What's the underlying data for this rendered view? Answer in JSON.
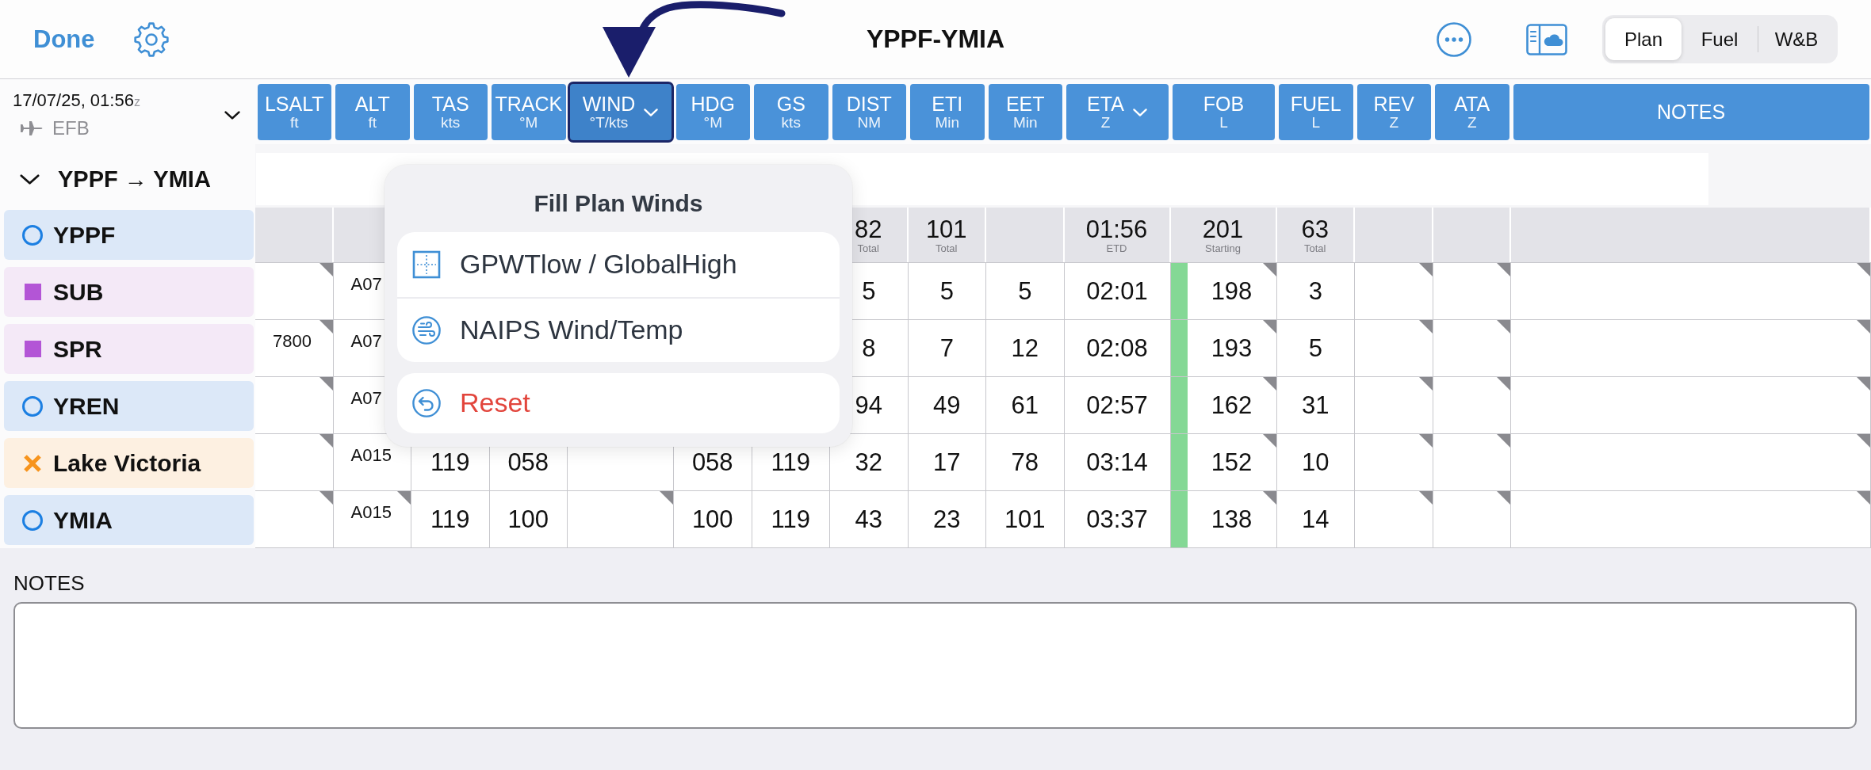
{
  "header": {
    "back": "Done",
    "title": "YPPF-YMIA",
    "segments": [
      {
        "label": "Plan",
        "selected": true
      },
      {
        "label": "Fuel",
        "selected": false
      },
      {
        "label": "W&B",
        "selected": false
      }
    ]
  },
  "plan_info": {
    "time": "17/07/25, 01:56",
    "zone": "z",
    "aircraft": "EFB"
  },
  "route": {
    "title": "YPPF → YMIA",
    "expanded": true,
    "waypoints": [
      {
        "name": "YPPF",
        "kind": "aerodrome"
      },
      {
        "name": "SUB",
        "kind": "fix"
      },
      {
        "name": "SPR",
        "kind": "fix"
      },
      {
        "name": "YREN",
        "kind": "aerodrome"
      },
      {
        "name": "Lake Victoria",
        "kind": "user"
      },
      {
        "name": "YMIA",
        "kind": "aerodrome"
      }
    ]
  },
  "table": {
    "columns": [
      {
        "label": "LSALT",
        "unit": "ft",
        "kind": "altitude",
        "menu": false,
        "selected": false
      },
      {
        "label": "ALT",
        "unit": "ft",
        "kind": "altitude",
        "menu": false,
        "selected": false
      },
      {
        "label": "TAS",
        "unit": "kts",
        "kind": "number",
        "menu": false,
        "selected": false
      },
      {
        "label": "TRACK",
        "unit": "°M",
        "kind": "number",
        "menu": false,
        "selected": false
      },
      {
        "label": "WIND",
        "unit": "°T/kts",
        "kind": "number",
        "menu": true,
        "selected": true
      },
      {
        "label": "HDG",
        "unit": "°M",
        "kind": "number",
        "menu": false,
        "selected": false
      },
      {
        "label": "GS",
        "unit": "kts",
        "kind": "number",
        "menu": false,
        "selected": false
      },
      {
        "label": "DIST",
        "unit": "NM",
        "kind": "number",
        "menu": false,
        "selected": false,
        "total": {
          "value": "82",
          "note": "Total"
        }
      },
      {
        "label": "ETI",
        "unit": "Min",
        "kind": "number",
        "menu": false,
        "selected": false,
        "total": {
          "value": "101",
          "note": "Total"
        }
      },
      {
        "label": "EET",
        "unit": "Min",
        "kind": "number",
        "menu": false,
        "selected": false
      },
      {
        "label": "ETA",
        "unit": "Z",
        "kind": "number",
        "menu": true,
        "selected": false,
        "total": {
          "value": "01:56",
          "note": "ETD"
        }
      },
      {
        "label": "FOB",
        "unit": "L",
        "kind": "fuel",
        "menu": false,
        "selected": false,
        "total": {
          "value": "201",
          "note": "Starting"
        }
      },
      {
        "label": "FUEL",
        "unit": "L",
        "kind": "number",
        "menu": false,
        "selected": false,
        "total": {
          "value": "63",
          "note": "Total"
        }
      },
      {
        "label": "REV",
        "unit": "Z",
        "kind": "number",
        "menu": false,
        "selected": false
      },
      {
        "label": "ATA",
        "unit": "Z",
        "kind": "number",
        "menu": false,
        "selected": false
      },
      {
        "label": "NOTES",
        "kind": "notes",
        "menu": false,
        "selected": false
      }
    ],
    "rows": [
      {
        "fuel_ok": true,
        "cells": {
          "lsalt": {
            "flagged": true
          },
          "alt": {
            "text": "A07"
          },
          "dist": {
            "text": "5",
            "flagged": false
          },
          "eti": {
            "text": "5",
            "flagged": false
          },
          "eet": {
            "text": "5",
            "flagged": false
          },
          "eta": {
            "text": "02:01",
            "flagged": false
          },
          "fob": {
            "text": "198",
            "flagged": true
          },
          "fuel": {
            "text": "3",
            "flagged": false
          },
          "rev": {
            "flagged": true
          },
          "ata": {
            "flagged": true
          },
          "notes": {
            "flagged": true
          }
        }
      },
      {
        "fuel_ok": true,
        "cells": {
          "lsalt": {
            "text": "7800",
            "flagged": true
          },
          "alt": {
            "text": "A07"
          },
          "dist": {
            "text": "8",
            "flagged": false
          },
          "eti": {
            "text": "7",
            "flagged": false
          },
          "eet": {
            "text": "12",
            "flagged": false
          },
          "eta": {
            "text": "02:08",
            "flagged": false
          },
          "fob": {
            "text": "193",
            "flagged": true
          },
          "fuel": {
            "text": "5",
            "flagged": false
          },
          "rev": {
            "flagged": true
          },
          "ata": {
            "flagged": true
          },
          "notes": {
            "flagged": true
          }
        }
      },
      {
        "fuel_ok": true,
        "cells": {
          "lsalt": {
            "flagged": true
          },
          "alt": {
            "text": "A07"
          },
          "dist": {
            "text": "94",
            "flagged": false
          },
          "eti": {
            "text": "49",
            "flagged": false
          },
          "eet": {
            "text": "61",
            "flagged": false
          },
          "eta": {
            "text": "02:57",
            "flagged": false
          },
          "fob": {
            "text": "162",
            "flagged": true
          },
          "fuel": {
            "text": "31",
            "flagged": false
          },
          "rev": {
            "flagged": true
          },
          "ata": {
            "flagged": true
          },
          "notes": {
            "flagged": true
          }
        }
      },
      {
        "fuel_ok": true,
        "cells": {
          "lsalt": {
            "flagged": true
          },
          "alt": {
            "text": "A015"
          },
          "tas": {
            "text": "119"
          },
          "track": {
            "text": "058"
          },
          "hdg": {
            "text": "058"
          },
          "gs": {
            "text": "119"
          },
          "dist": {
            "text": "32",
            "flagged": false
          },
          "eti": {
            "text": "17",
            "flagged": false
          },
          "eet": {
            "text": "78",
            "flagged": false
          },
          "eta": {
            "text": "03:14",
            "flagged": false
          },
          "fob": {
            "text": "152",
            "flagged": true
          },
          "fuel": {
            "text": "10",
            "flagged": false
          },
          "rev": {
            "flagged": true
          },
          "ata": {
            "flagged": true
          },
          "notes": {
            "flagged": true
          }
        }
      },
      {
        "fuel_ok": true,
        "cells": {
          "lsalt": {
            "flagged": true
          },
          "alt": {
            "text": "A015",
            "flagged": true
          },
          "tas": {
            "text": "119",
            "flagged": false
          },
          "track": {
            "text": "100",
            "flagged": false
          },
          "wind": {
            "flagged": true
          },
          "hdg": {
            "text": "100",
            "flagged": false
          },
          "gs": {
            "text": "119",
            "flagged": false
          },
          "dist": {
            "text": "43",
            "flagged": false
          },
          "eti": {
            "text": "23",
            "flagged": false
          },
          "eet": {
            "text": "101",
            "flagged": false
          },
          "eta": {
            "text": "03:37",
            "flagged": false
          },
          "fob": {
            "text": "138",
            "flagged": true
          },
          "fuel": {
            "text": "14",
            "flagged": false
          },
          "rev": {
            "flagged": true
          },
          "ata": {
            "flagged": true
          },
          "notes": {
            "flagged": true
          }
        }
      }
    ]
  },
  "wind_menu": {
    "title": "Fill Plan Winds",
    "sections": [
      {
        "items": [
          {
            "label": "GPWTlow / GlobalHigh",
            "kind": "grid"
          },
          {
            "label": "NAIPS Wind/Temp",
            "kind": "wind"
          }
        ]
      },
      {
        "items": [
          {
            "label": "Reset",
            "kind": "reset"
          }
        ]
      }
    ]
  },
  "notes": {
    "label": "NOTES"
  }
}
